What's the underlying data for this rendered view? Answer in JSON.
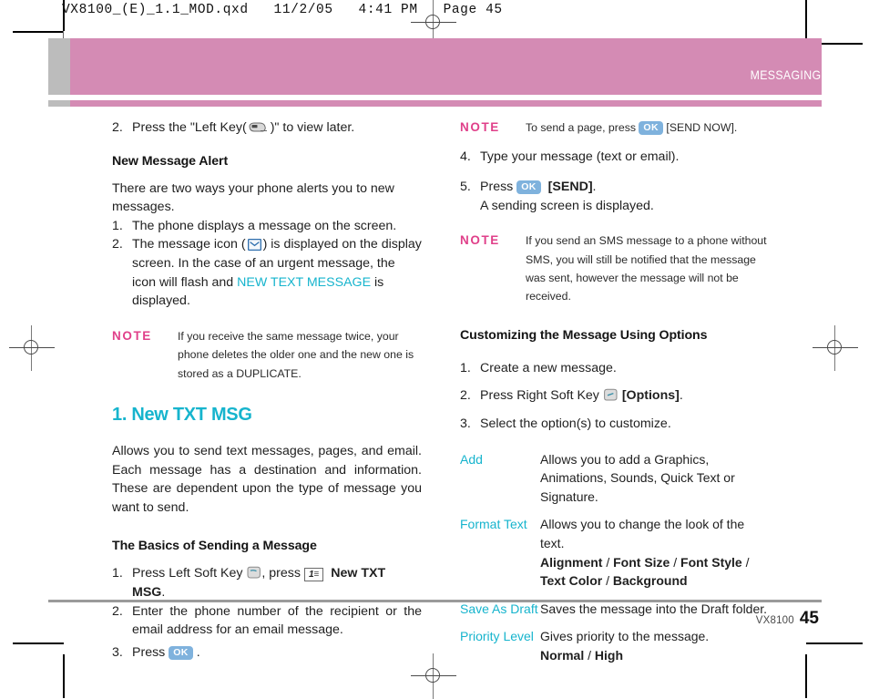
{
  "prepress": {
    "file_info": "VX8100_(E)_1.1_MOD.qxd   11/2/05   4:41 PM   Page 45"
  },
  "banner": {
    "section_title": "MESSAGING",
    "bg_color": "#d48bb4",
    "tab_color": "#bcbcbc",
    "text_color": "#ffffff"
  },
  "footer": {
    "model": "VX8100",
    "page_number": "45"
  },
  "colors": {
    "cyan": "#16b4cd",
    "note_pink": "#e0408a",
    "ok_key_blue": "#7fb2dd"
  },
  "left_column": {
    "item_2_view_later": {
      "num": "2.",
      "before_icon": "Press the \"Left Key(",
      "icon": "left-key-icon",
      "after_icon": ")\" to view later."
    },
    "new_message_alert": {
      "heading": "New Message Alert",
      "intro": "There are two ways your phone alerts you to new messages.",
      "items": [
        {
          "num": "1.",
          "text": "The phone displays a message on the screen."
        },
        {
          "num": "2.",
          "before_icon": "The message icon (",
          "icon": "envelope-icon",
          "after_icon": ") is displayed on the display screen. In the case of an urgent message, the icon will flash and ",
          "highlight": "NEW TEXT MESSAGE",
          "tail": " is displayed."
        }
      ]
    },
    "note": {
      "label": "NOTE",
      "text": "If you receive the same message twice, your phone deletes the older one and the new one is stored as a DUPLICATE."
    },
    "new_txt_msg": {
      "heading": "1. New TXT MSG",
      "body": "Allows you to send text messages, pages, and email. Each message has a destination and information. These are dependent upon the type of message you want to send."
    },
    "basics": {
      "heading": "The Basics of Sending a Message",
      "step1": {
        "num": "1.",
        "before_icon": "Press Left Soft Key",
        "icon": "left-soft-key-icon",
        "middle": ", press",
        "key_label": "1",
        "key_sub": "☰",
        "bold_tail": "New TXT MSG",
        "period": "."
      },
      "step2": {
        "num": "2.",
        "text": "Enter the phone number of the recipient or the email address for an email message."
      },
      "step3": {
        "num": "3.",
        "before_icon": "Press",
        "icon": "ok-key-icon",
        "key_label": "OK",
        "after_icon": "."
      }
    }
  },
  "right_column": {
    "note_send_page": {
      "label": "NOTE",
      "before_key": "To send a page, press",
      "key_label": "OK",
      "after_key": "[SEND NOW]."
    },
    "steps": [
      {
        "num": "4.",
        "text": "Type your message (text or email)."
      },
      {
        "num": "5.",
        "before_key": "Press",
        "key_label": "OK",
        "bold_tail": "[SEND]",
        "period": ".",
        "subline": "A sending screen is displayed."
      }
    ],
    "note_sms": {
      "label": "NOTE",
      "text": "If you send an SMS message to a phone without SMS, you will still be notified that the message was sent, however the message will not be received."
    },
    "customizing": {
      "heading": "Customizing the Message Using Options",
      "steps": [
        {
          "num": "1.",
          "text": "Create a new message."
        },
        {
          "num": "2.",
          "before_icon": "Press Right Soft Key",
          "icon": "right-soft-key-icon",
          "bold_tail": "[Options]",
          "period": "."
        },
        {
          "num": "3.",
          "text": "Select the option(s) to customize."
        }
      ],
      "options": [
        {
          "term": "Add",
          "desc": "Allows you to add a Graphics, Animations, Sounds, Quick Text or Signature.",
          "values": []
        },
        {
          "term": "Format Text",
          "desc": "Allows you to change the look of the text.",
          "values": [
            "Alignment",
            "Font Size",
            "Font Style",
            "Text Color",
            "Background"
          ],
          "values_line_break_after": 3
        },
        {
          "term": "Save As Draft",
          "desc": "Saves the message into the Draft folder.",
          "values": []
        },
        {
          "term": "Priority Level",
          "desc": "Gives priority to the message.",
          "values": [
            "Normal",
            "High"
          ]
        }
      ]
    }
  }
}
